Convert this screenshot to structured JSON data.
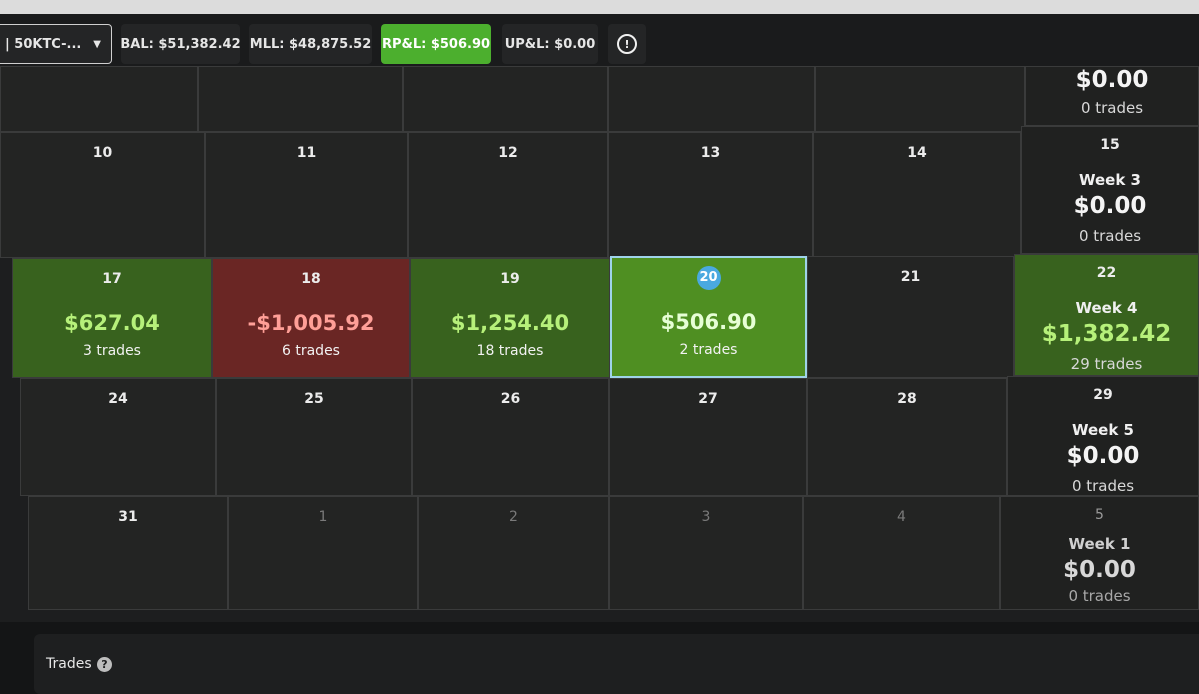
{
  "toolbar": {
    "account": "| 50KTC-...",
    "bal": "BAL: $51,382.42",
    "mll": "MLL: $48,875.52",
    "rpl": "RP&L: $506.90",
    "upl": "UP&L: $0.00",
    "alert_icon": "!"
  },
  "calendar": {
    "row0": {
      "week_total": {
        "amount": "$0.00",
        "trades": "0 trades"
      }
    },
    "row1": {
      "days": [
        "10",
        "11",
        "12",
        "13",
        "14"
      ],
      "week": {
        "day": "15",
        "label": "Week 3",
        "amount": "$0.00",
        "trades": "0 trades"
      }
    },
    "row2": {
      "days": [
        {
          "day": "17",
          "amount": "$627.04",
          "trades": "3 trades",
          "status": "profit"
        },
        {
          "day": "18",
          "amount": "-$1,005.92",
          "trades": "6 trades",
          "status": "loss"
        },
        {
          "day": "19",
          "amount": "$1,254.40",
          "trades": "18 trades",
          "status": "profit"
        },
        {
          "day": "20",
          "amount": "$506.90",
          "trades": "2 trades",
          "status": "today"
        },
        {
          "day": "21"
        }
      ],
      "week": {
        "day": "22",
        "label": "Week 4",
        "amount": "$1,382.42",
        "trades": "29 trades"
      }
    },
    "row3": {
      "days": [
        "24",
        "25",
        "26",
        "27",
        "28"
      ],
      "week": {
        "day": "29",
        "label": "Week 5",
        "amount": "$0.00",
        "trades": "0 trades"
      }
    },
    "row4": {
      "days": [
        "31",
        "1",
        "2",
        "3",
        "4"
      ],
      "week": {
        "day": "5",
        "label": "Week 1",
        "amount": "$0.00",
        "trades": "0 trades"
      }
    }
  },
  "trades_panel": {
    "title": "Trades",
    "help_icon": "?"
  },
  "colors": {
    "profit": "#38621e",
    "loss": "#6a2624",
    "today": "#4f8f22",
    "accent_green": "#4caf2e",
    "today_badge": "#4aa9e0"
  }
}
